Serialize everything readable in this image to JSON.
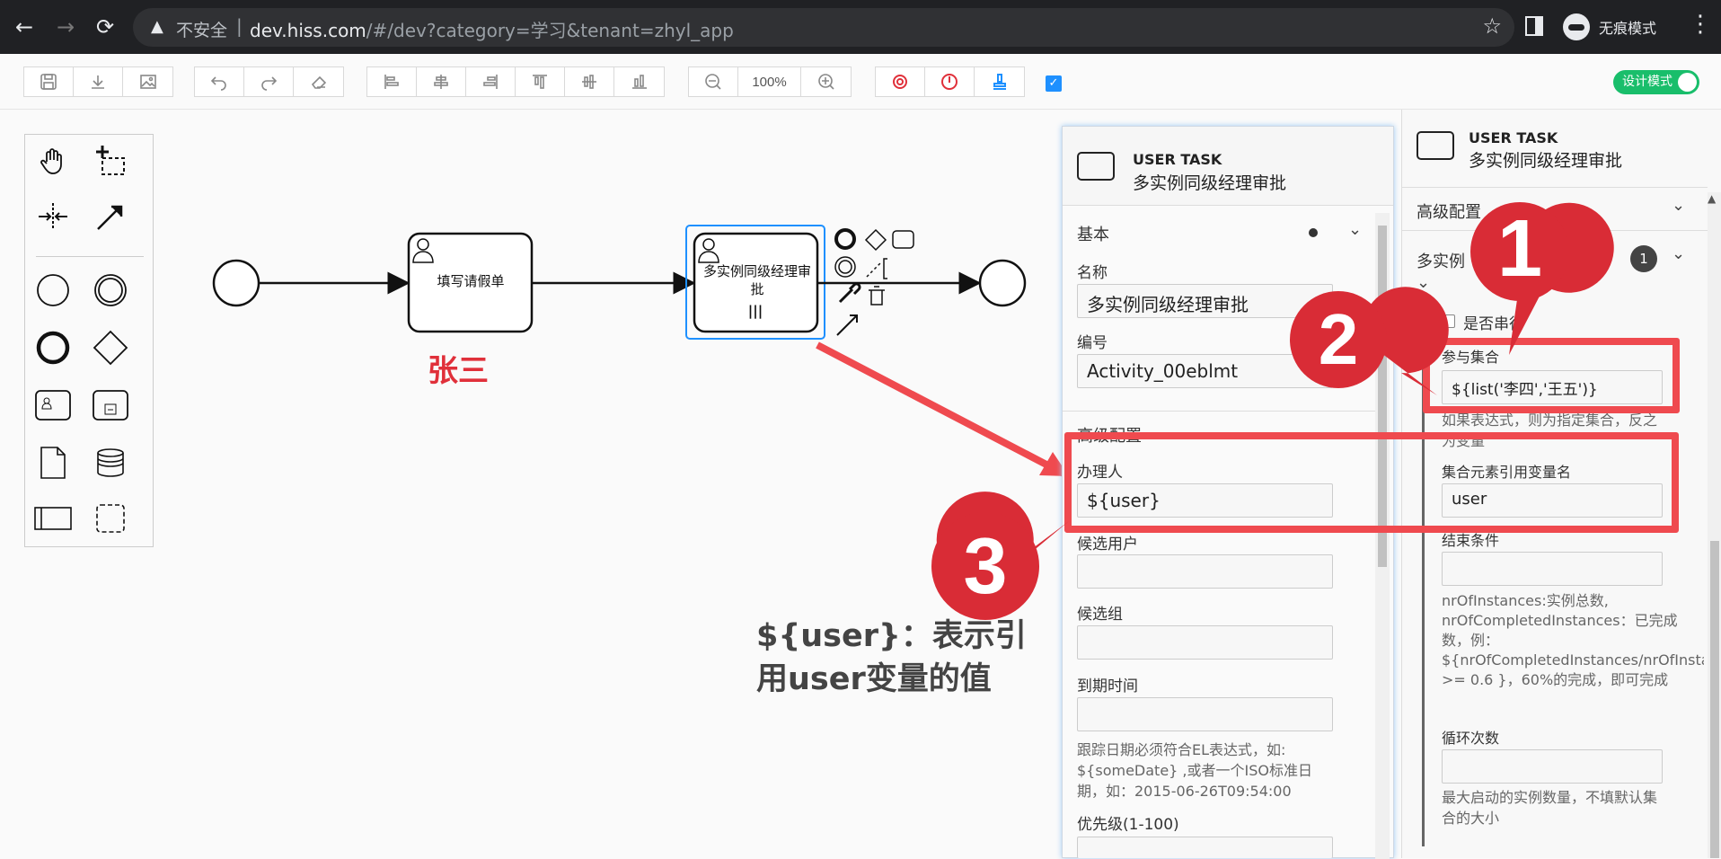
{
  "browser": {
    "nav": {
      "back": "←",
      "forward": "→",
      "reload": "⟳"
    },
    "url_warning_icon": "▲",
    "insecure_label": "不安全",
    "separator": "|",
    "host": "dev.hiss.com",
    "path": "/#/dev?category=学习&tenant=zhyl_app",
    "star": "☆",
    "incognito_label": "无痕模式",
    "menu": "⋮"
  },
  "toolbar": {
    "zoom": "100%",
    "design_mode_label": "设计模式",
    "icons": [
      "save-icon",
      "download-icon",
      "image-icon",
      "undo-icon",
      "redo-icon",
      "eraser-icon",
      "align-left-icon",
      "align-center-icon",
      "align-right-icon",
      "align-top-icon",
      "align-middle-icon",
      "align-bottom-icon",
      "zoom-out-icon",
      "zoom-in-icon",
      "simulation-icon",
      "power-icon",
      "stamp-icon",
      "checkbox-icon"
    ],
    "accent_colors": {
      "red": "#e0303a",
      "blue": "#1e90ff",
      "green": "#19be6b"
    }
  },
  "diagram": {
    "task1_label": "填写请假单",
    "task2_label": "多实例同级经理审批",
    "task2_marker": "|||",
    "assignee_note": "张三",
    "explanation": "${user}：表示引用user变量的值"
  },
  "mid_panel": {
    "type": "USER TASK",
    "name": "多实例同级经理审批",
    "group_basic": "基本",
    "name_label": "名称",
    "name_value": "多实例同级经理审批",
    "id_label": "编号",
    "id_value": "Activity_00eblmt",
    "group_advanced": "高级配置",
    "assignee_label": "办理人",
    "assignee_value": "${user}",
    "candidate_users_label": "候选用户",
    "candidate_groups_label": "候选组",
    "due_date_label": "到期时间",
    "due_date_hint": "跟踪日期必须符合EL表达式，如: ${someDate} ,或者一个ISO标准日期，如：2015-06-26T09:54:00",
    "priority_label": "优先级(1-100)"
  },
  "right_panel": {
    "type": "USER TASK",
    "name": "多实例同级经理审批",
    "group_advanced": "高级配置",
    "group_multi": "多实例",
    "multi_badge": "1",
    "sequential_label": "是否串行",
    "collection_label": "参与集合",
    "collection_value": "${list('李四','王五')}",
    "collection_hint": "如果表达式，则为指定集合，反之为变量",
    "element_var_label": "集合元素引用变量名",
    "element_var_value": "user",
    "completion_label": "结束条件",
    "completion_hint": "nrOfInstances:实例总数, nrOfCompletedInstances：已完成数，例：${nrOfCompletedInstances/nrOfInstances >= 0.6 }，60%的完成，即可完成",
    "loop_label": "循环次数",
    "loop_hint": "最大启动的实例数量，不填默认集合的大小"
  },
  "callouts": {
    "one": "1",
    "two": "2",
    "three": "3"
  }
}
